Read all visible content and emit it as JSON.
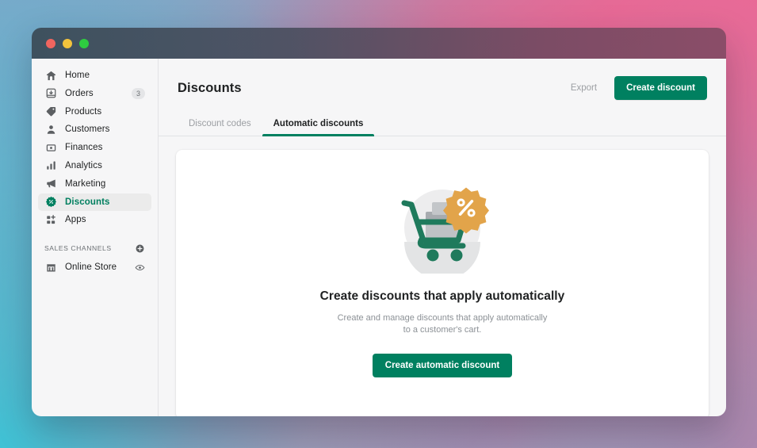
{
  "window": {
    "traffic_lights": [
      "close",
      "minimize",
      "zoom"
    ],
    "colors": {
      "accent_green": "#008060",
      "titlebar_left": "#3A4A56",
      "titlebar_right": "#7C4860",
      "badge_gold": "#E2A44A",
      "sidebar_bg": "#F6F6F7"
    }
  },
  "sidebar": {
    "items": [
      {
        "label": "Home",
        "icon": "home-icon",
        "badge": ""
      },
      {
        "label": "Orders",
        "icon": "orders-icon",
        "badge": "3"
      },
      {
        "label": "Products",
        "icon": "products-tag-icon",
        "badge": ""
      },
      {
        "label": "Customers",
        "icon": "customers-person-icon",
        "badge": ""
      },
      {
        "label": "Finances",
        "icon": "finances-bill-icon",
        "badge": ""
      },
      {
        "label": "Analytics",
        "icon": "analytics-bar-chart-icon",
        "badge": ""
      },
      {
        "label": "Marketing",
        "icon": "marketing-megaphone-icon",
        "badge": ""
      },
      {
        "label": "Discounts",
        "icon": "discounts-percent-badge-icon",
        "badge": ""
      },
      {
        "label": "Apps",
        "icon": "apps-grid-plus-icon",
        "badge": ""
      }
    ],
    "active_item": "Discounts",
    "section": {
      "title": "SALES CHANNELS",
      "add_icon": "plus-circle-icon",
      "channels": [
        {
          "label": "Online Store",
          "icon": "storefront-icon",
          "action_icon": "eye-icon"
        }
      ]
    }
  },
  "header": {
    "title": "Discounts",
    "export_label": "Export",
    "create_label": "Create discount"
  },
  "tabs": [
    {
      "label": "Discount codes",
      "active": false
    },
    {
      "label": "Automatic discounts",
      "active": true
    }
  ],
  "empty_state": {
    "illustration": "shopping-cart-with-percent-badge-illustration",
    "title": "Create discounts that apply automatically",
    "subtitle": "Create and manage discounts that apply automatically to a customer's cart.",
    "button_label": "Create automatic discount"
  }
}
